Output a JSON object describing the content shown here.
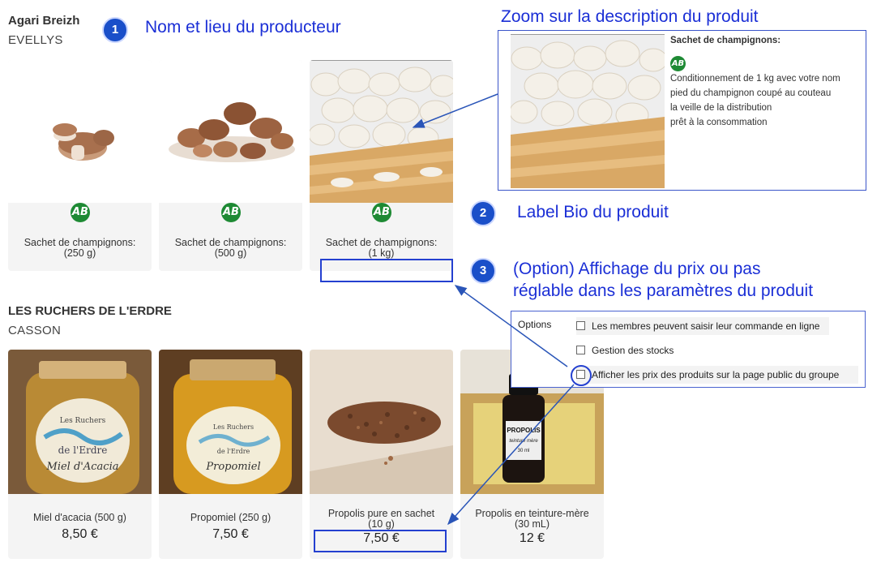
{
  "producers": [
    {
      "name": "Agari Breizh",
      "location": "EVELLYS"
    },
    {
      "name": "LES RUCHERS DE L'ERDRE",
      "location": "CASSON"
    }
  ],
  "products_row1": [
    {
      "label": "Sachet de champignons:\n(250 g)",
      "badge": "AB"
    },
    {
      "label": "Sachet de champignons:\n(500 g)",
      "badge": "AB"
    },
    {
      "label": "Sachet de champignons:\n(1 kg)",
      "badge": "AB"
    }
  ],
  "products_row2": [
    {
      "label": "Miel d'acacia (500 g)",
      "price": "8,50 €",
      "jar_text_1": "Les Ruchers",
      "jar_text_2": "de l'Erdre",
      "jar_text_3": "Miel d'Acacia"
    },
    {
      "label": "Propomiel (250 g)",
      "price": "7,50 €",
      "jar_text_1": "Les Ruchers",
      "jar_text_2": "de l'Erdre",
      "jar_text_3": "Propomiel"
    },
    {
      "label": "Propolis pure en sachet\n(10 g)",
      "price": "7,50 €"
    },
    {
      "label": "Propolis en teinture-mère\n(30 mL)",
      "price": "12 €",
      "bottle_text_1": "PROPOLIS",
      "bottle_text_2": "teinture mère",
      "bottle_text_3": "30 ml"
    }
  ],
  "annotations": {
    "a1": {
      "number": "1",
      "text": "Nom et lieu du producteur"
    },
    "a2": {
      "number": "2",
      "text": "Label Bio du produit"
    },
    "a3": {
      "number": "3",
      "line1": "(Option) Affichage du prix ou pas",
      "line2": "réglable dans les paramètres du produit"
    },
    "zoom_title": "Zoom sur la description du produit"
  },
  "zoom": {
    "title": "Sachet de champignons:",
    "badge": "AB",
    "lines": [
      "Conditionnement de 1 kg avec votre nom",
      "pied du champignon coupé au couteau",
      "la veille de la distribution",
      "prêt à la consommation"
    ]
  },
  "options": {
    "label": "Options",
    "items": [
      {
        "text": "Les membres peuvent saisir leur commande en ligne",
        "checked": false
      },
      {
        "text": "Gestion des stocks",
        "checked": false
      },
      {
        "text": "Afficher les prix des produits sur la page public du groupe",
        "checked": false
      }
    ]
  },
  "colors": {
    "annotation_blue": "#1b2fd6",
    "bio_green": "#1e8a34",
    "card_bg": "#f4f4f4"
  }
}
